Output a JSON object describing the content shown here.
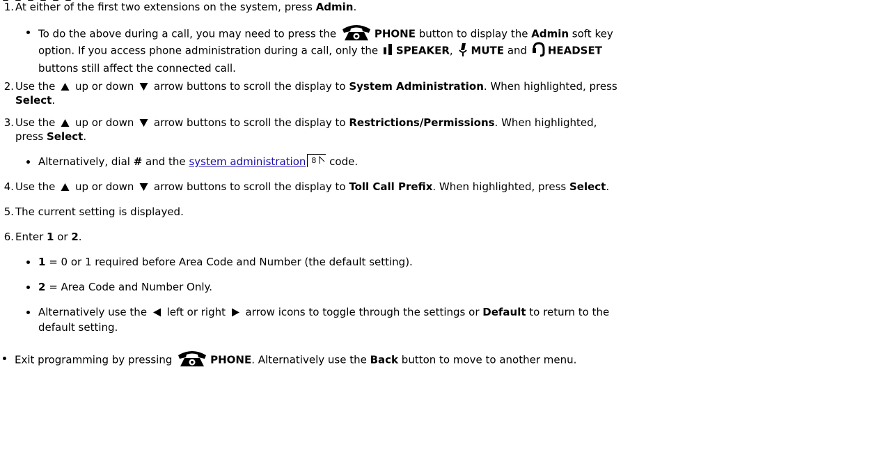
{
  "icons": {
    "phone": "phone-icon",
    "speaker": "speaker-icon",
    "mute": "mute-icon",
    "headset": "headset-icon",
    "arrow_up": "up-arrow-icon",
    "arrow_down": "down-arrow-icon",
    "arrow_left": "left-arrow-icon",
    "arrow_right": "right-arrow-icon"
  },
  "steps": [
    {
      "num": "1.",
      "parts": [
        "At either of the first two extensions on the system, press ",
        "Admin",
        "."
      ]
    },
    {
      "num": "2.",
      "line1": [
        "Use the ",
        " up or down ",
        " arrow buttons to scroll the display to ",
        "System Administration",
        ". When highlighted, press"
      ],
      "line2": [
        "Select",
        "."
      ]
    },
    {
      "num": "3.",
      "line1": [
        "Use the ",
        " up or down ",
        " arrow buttons to scroll the display to ",
        "Restrictions/Permissions",
        ". When highlighted,"
      ],
      "line2": [
        "press ",
        "Select",
        "."
      ]
    },
    {
      "num": "4.",
      "parts": [
        "Use the ",
        " up or down ",
        " arrow buttons to scroll the display to ",
        "Toll Call Prefix",
        ". When highlighted, press ",
        "Select",
        "."
      ]
    },
    {
      "num": "5.",
      "text": "The current setting is displayed."
    },
    {
      "num": "6.",
      "parts": [
        "Enter ",
        "1",
        " or ",
        "2",
        "."
      ]
    }
  ],
  "bullet_call": {
    "line1": [
      "To do the above during a call, you may need to press the ",
      "PHONE",
      " button to display the ",
      "Admin",
      " soft key"
    ],
    "line2": [
      "option. If you access phone administration during a call, only the ",
      "SPEAKER",
      ", ",
      "MUTE",
      " and ",
      "HEADSET"
    ],
    "line3": "buttons still affect the connected call."
  },
  "bullet_dial": {
    "parts": [
      "Alternatively, dial ",
      "#",
      " and the ",
      "system administration",
      " code."
    ],
    "page_ref": "8"
  },
  "bullet_opt1": {
    "key": "1",
    "text": " = 0 or 1 required before Area Code and Number (the default setting)."
  },
  "bullet_opt2": {
    "key": "2",
    "text": " = Area Code and Number Only."
  },
  "bullet_toggle": {
    "line1": [
      "Alternatively use the ",
      " left or right ",
      " arrow icons to toggle through the settings or ",
      "Default",
      " to return to the"
    ],
    "line2": "default setting."
  },
  "bullet_exit": {
    "parts": [
      "Exit programming by pressing ",
      "PHONE",
      ". Alternatively use the ",
      "Back",
      " button to move to another menu."
    ]
  }
}
